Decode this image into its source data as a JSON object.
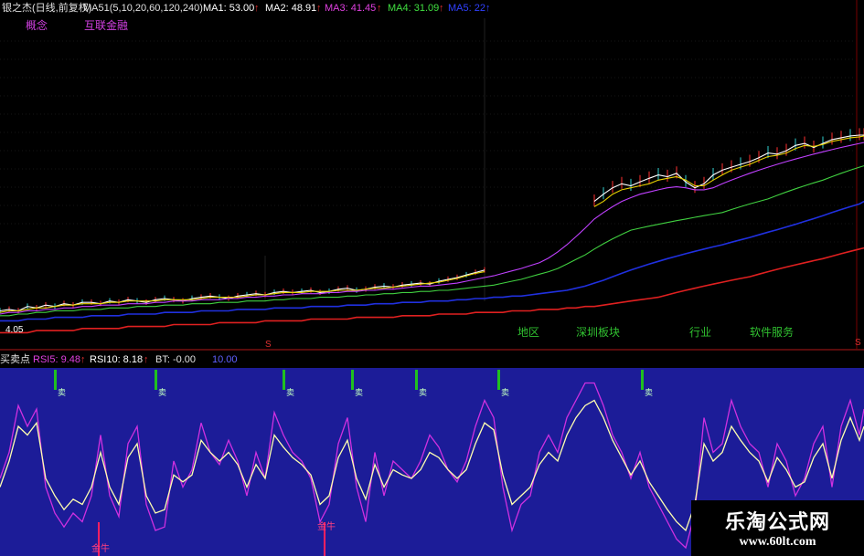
{
  "colors": {
    "ma1": "#ffffff",
    "ma2": "#e6d000",
    "ma3": "#c040ff",
    "ma4": "#40d040",
    "ma5": "#2030e0",
    "ma6": "#e02020",
    "rsi5": "#d030e0",
    "rsi10": "#ffffb0",
    "lower_bg": "#1c1c98",
    "sell_flag": "#20c020",
    "buy_flag": "#ff2060",
    "concept_text": "#d040e0",
    "sector_text": "#30c030"
  },
  "header": {
    "title": "银之杰(日线,前复权)",
    "ma_label": "MA51(5,10,20,60,120,240)",
    "ma_values": [
      {
        "label": "MA1: 53.00",
        "color": "#ffffff"
      },
      {
        "label": "MA2: 48.91",
        "color": "#ffffff"
      },
      {
        "label": "MA3: 41.45",
        "color": "#e040e0"
      },
      {
        "label": "MA4: 31.09",
        "color": "#40e040"
      },
      {
        "label": "MA5: 22",
        "color": "#3040ff"
      }
    ],
    "concept_label": "概念",
    "concept_value": "互联金融"
  },
  "sector_labels": [
    "地区",
    "深圳板块",
    "行业",
    "软件服务"
  ],
  "low_price_label": "4.05",
  "lower": {
    "title": "买卖点",
    "legend": [
      {
        "label": "RSI5: 9.48",
        "color": "#e040e0"
      },
      {
        "label": "RSI10: 8.18",
        "color": "#ffffff"
      },
      {
        "label": "BT: -0.00",
        "color": "#e0e0e0"
      },
      {
        "label": "10.00",
        "color": "#6060ff"
      }
    ],
    "sell_label": "卖",
    "buy_labels": [
      "金牛",
      "金牛"
    ]
  },
  "watermark": {
    "line1": "乐淘公式网",
    "line2": "www.60lt.com"
  },
  "chart_data": [
    {
      "type": "line",
      "panel": "price",
      "x": [
        0,
        10,
        20,
        30,
        40,
        50,
        60,
        70,
        80,
        90,
        100,
        110,
        120,
        130,
        140,
        150,
        160,
        170,
        180,
        190,
        200,
        210,
        220,
        230,
        240,
        250,
        260,
        270,
        280,
        290,
        300,
        310,
        320,
        330,
        340,
        350,
        360,
        370,
        380,
        390,
        400,
        410,
        420,
        430,
        440,
        450,
        460,
        470,
        480,
        490,
        500,
        510,
        520,
        530,
        540,
        550,
        560,
        570,
        580,
        590,
        600,
        610,
        620,
        630,
        640,
        650,
        660,
        670,
        680,
        690,
        700,
        710,
        720,
        730,
        740,
        750,
        760,
        770,
        780,
        790,
        800,
        810,
        820,
        830,
        840,
        850,
        860,
        870,
        880,
        890,
        900,
        910,
        920,
        930,
        940,
        945
      ],
      "series": [
        {
          "name": "MA1",
          "values": [
            4.0,
            4.1,
            4.0,
            4.3,
            4.2,
            4.4,
            4.3,
            4.5,
            4.4,
            4.6,
            4.6,
            4.5,
            4.7,
            4.6,
            4.8,
            4.7,
            4.6,
            4.8,
            4.9,
            4.8,
            4.7,
            4.9,
            5.0,
            5.1,
            5.0,
            4.9,
            5.1,
            5.2,
            5.3,
            5.2,
            5.4,
            5.5,
            5.4,
            5.5,
            5.6,
            5.4,
            5.5,
            5.7,
            5.8,
            5.6,
            5.7,
            5.9,
            6.0,
            5.9,
            6.1,
            6.2,
            6.3,
            6.2,
            6.5,
            6.7,
            6.9,
            7.2,
            7.5,
            7.8,
            null,
            null,
            null,
            null,
            null,
            null,
            null,
            null,
            null,
            null,
            null,
            24,
            27,
            30,
            32,
            31,
            33,
            35,
            37,
            36,
            38,
            33,
            30,
            32,
            37,
            40,
            42,
            44,
            46,
            49,
            53,
            52,
            55,
            60,
            62,
            58,
            62,
            66,
            68,
            70,
            71,
            71
          ]
        },
        {
          "name": "MA2",
          "values": [
            3.9,
            4.0,
            4.0,
            4.1,
            4.2,
            4.2,
            4.3,
            4.4,
            4.4,
            4.5,
            4.5,
            4.5,
            4.6,
            4.6,
            4.7,
            4.7,
            4.7,
            4.7,
            4.8,
            4.8,
            4.8,
            4.8,
            4.9,
            5.0,
            5.0,
            5.0,
            5.0,
            5.1,
            5.2,
            5.2,
            5.3,
            5.4,
            5.4,
            5.4,
            5.5,
            5.5,
            5.5,
            5.6,
            5.6,
            5.6,
            5.7,
            5.8,
            5.8,
            5.9,
            6.0,
            6.1,
            6.2,
            6.3,
            6.4,
            6.6,
            6.8,
            7.1,
            7.4,
            7.6,
            null,
            null,
            null,
            null,
            null,
            null,
            null,
            null,
            null,
            null,
            null,
            22,
            24,
            27,
            29,
            30,
            31,
            32,
            34,
            35,
            36,
            34,
            31,
            31,
            34,
            37,
            40,
            42,
            44,
            47,
            50,
            51,
            53,
            57,
            60,
            59,
            61,
            64,
            66,
            68,
            69,
            70
          ]
        },
        {
          "name": "MA3",
          "values": [
            3.8,
            3.9,
            3.9,
            4.0,
            4.0,
            4.1,
            4.1,
            4.2,
            4.2,
            4.3,
            4.3,
            4.4,
            4.4,
            4.4,
            4.5,
            4.5,
            4.5,
            4.6,
            4.6,
            4.7,
            4.7,
            4.7,
            4.8,
            4.8,
            4.8,
            4.9,
            4.9,
            5.0,
            5.0,
            5.1,
            5.1,
            5.2,
            5.2,
            5.3,
            5.3,
            5.3,
            5.4,
            5.4,
            5.5,
            5.5,
            5.6,
            5.6,
            5.7,
            5.7,
            5.8,
            5.9,
            6.0,
            6.0,
            6.1,
            6.2,
            6.3,
            6.5,
            6.7,
            6.9,
            7.1,
            7.4,
            7.7,
            8.0,
            8.4,
            8.8,
            9.5,
            10.5,
            11.8,
            13.5,
            15.5,
            18,
            20,
            22,
            24,
            25.5,
            27,
            28,
            29,
            30,
            30.5,
            30,
            29,
            29,
            30,
            32,
            34,
            36,
            38,
            40,
            42,
            44,
            46,
            48,
            50,
            52,
            54,
            56,
            58,
            60,
            62,
            63
          ]
        },
        {
          "name": "MA4",
          "values": [
            3.7,
            3.7,
            3.8,
            3.8,
            3.9,
            3.9,
            4.0,
            4.0,
            4.0,
            4.1,
            4.1,
            4.1,
            4.2,
            4.2,
            4.2,
            4.3,
            4.3,
            4.3,
            4.4,
            4.4,
            4.4,
            4.5,
            4.5,
            4.5,
            4.6,
            4.6,
            4.6,
            4.7,
            4.7,
            4.7,
            4.8,
            4.8,
            4.9,
            4.9,
            4.9,
            5.0,
            5.0,
            5.0,
            5.1,
            5.1,
            5.2,
            5.2,
            5.3,
            5.3,
            5.4,
            5.4,
            5.5,
            5.5,
            5.6,
            5.6,
            5.7,
            5.8,
            5.9,
            6.0,
            6.1,
            6.3,
            6.5,
            6.7,
            7.0,
            7.3,
            7.6,
            8.0,
            8.6,
            9.3,
            10,
            11,
            12,
            13,
            14,
            15,
            15.5,
            16,
            16.5,
            17,
            17.5,
            18,
            18.5,
            19,
            19.5,
            20,
            21,
            22,
            23,
            24,
            25,
            26.5,
            28,
            29.5,
            31,
            32.5,
            34,
            36,
            38,
            40,
            42,
            43
          ]
        },
        {
          "name": "MA5",
          "values": [
            3.4,
            3.4,
            3.4,
            3.5,
            3.5,
            3.5,
            3.6,
            3.6,
            3.6,
            3.6,
            3.7,
            3.7,
            3.7,
            3.7,
            3.8,
            3.8,
            3.8,
            3.8,
            3.9,
            3.9,
            3.9,
            3.9,
            4.0,
            4.0,
            4.0,
            4.0,
            4.1,
            4.1,
            4.1,
            4.1,
            4.2,
            4.2,
            4.2,
            4.2,
            4.3,
            4.3,
            4.3,
            4.3,
            4.4,
            4.4,
            4.4,
            4.5,
            4.5,
            4.5,
            4.6,
            4.6,
            4.6,
            4.7,
            4.7,
            4.7,
            4.8,
            4.8,
            4.9,
            4.9,
            5.0,
            5.0,
            5.1,
            5.1,
            5.2,
            5.3,
            5.4,
            5.5,
            5.6,
            5.8,
            6.0,
            6.3,
            6.6,
            7.0,
            7.4,
            7.8,
            8.2,
            8.6,
            9,
            9.4,
            9.8,
            10.2,
            10.6,
            11,
            11.4,
            11.8,
            12.3,
            12.8,
            13.3,
            13.9,
            14.5,
            15.1,
            15.8,
            16.5,
            17.3,
            18.1,
            19,
            20,
            21,
            22,
            23,
            24
          ]
        },
        {
          "name": "MA6",
          "values": [
            2.8,
            2.8,
            2.8,
            2.8,
            2.9,
            2.9,
            2.9,
            2.9,
            2.9,
            3.0,
            3.0,
            3.0,
            3.0,
            3.0,
            3.1,
            3.1,
            3.1,
            3.1,
            3.1,
            3.2,
            3.2,
            3.2,
            3.2,
            3.2,
            3.3,
            3.3,
            3.3,
            3.3,
            3.3,
            3.4,
            3.4,
            3.4,
            3.4,
            3.4,
            3.5,
            3.5,
            3.5,
            3.5,
            3.5,
            3.6,
            3.6,
            3.6,
            3.6,
            3.6,
            3.7,
            3.7,
            3.7,
            3.7,
            3.8,
            3.8,
            3.8,
            3.8,
            3.9,
            3.9,
            3.9,
            3.9,
            4.0,
            4.0,
            4.0,
            4.1,
            4.1,
            4.1,
            4.2,
            4.2,
            4.3,
            4.3,
            4.4,
            4.5,
            4.6,
            4.7,
            4.8,
            4.9,
            5.0,
            5.2,
            5.4,
            5.6,
            5.8,
            6.0,
            6.2,
            6.4,
            6.6,
            6.8,
            7.0,
            7.3,
            7.6,
            7.9,
            8.2,
            8.5,
            8.8,
            9.1,
            9.4,
            9.8,
            10.2,
            10.6,
            11,
            11.2
          ]
        }
      ]
    },
    {
      "type": "line",
      "panel": "rsi",
      "ylim": [
        0,
        100
      ],
      "x": [
        0,
        10,
        20,
        30,
        40,
        50,
        60,
        70,
        80,
        90,
        100,
        110,
        120,
        130,
        140,
        150,
        160,
        170,
        180,
        190,
        200,
        210,
        220,
        230,
        240,
        250,
        260,
        270,
        280,
        290,
        300,
        310,
        320,
        330,
        340,
        350,
        360,
        370,
        380,
        390,
        400,
        410,
        420,
        430,
        440,
        450,
        460,
        470,
        480,
        490,
        500,
        510,
        520,
        530,
        540,
        550,
        560,
        570,
        580,
        590,
        600,
        610,
        620,
        630,
        640,
        650,
        660,
        670,
        680,
        690,
        700,
        710,
        720,
        730,
        740,
        750,
        760,
        770,
        780,
        790,
        800,
        810,
        820,
        830,
        840,
        850,
        860,
        870,
        880,
        890,
        900,
        910,
        920,
        930,
        940,
        945
      ],
      "series": [
        {
          "name": "RSI5",
          "values": [
            40,
            55,
            82,
            70,
            80,
            35,
            20,
            12,
            20,
            15,
            30,
            65,
            30,
            18,
            60,
            70,
            25,
            10,
            12,
            50,
            35,
            45,
            72,
            55,
            48,
            62,
            50,
            30,
            55,
            40,
            78,
            65,
            55,
            50,
            40,
            15,
            25,
            60,
            75,
            35,
            15,
            55,
            30,
            50,
            45,
            40,
            50,
            65,
            58,
            45,
            38,
            50,
            70,
            85,
            75,
            35,
            10,
            25,
            30,
            55,
            65,
            55,
            75,
            85,
            95,
            95,
            82,
            65,
            55,
            40,
            55,
            35,
            25,
            15,
            5,
            0,
            20,
            75,
            55,
            60,
            85,
            70,
            60,
            55,
            35,
            60,
            50,
            30,
            40,
            60,
            70,
            35,
            70,
            85,
            65,
            80
          ]
        },
        {
          "name": "RSI10",
          "values": [
            35,
            50,
            70,
            65,
            72,
            40,
            30,
            22,
            28,
            25,
            35,
            55,
            35,
            25,
            52,
            60,
            30,
            20,
            22,
            42,
            38,
            42,
            62,
            55,
            50,
            55,
            48,
            35,
            48,
            40,
            65,
            58,
            52,
            48,
            42,
            25,
            30,
            52,
            62,
            40,
            28,
            48,
            35,
            45,
            42,
            40,
            45,
            55,
            52,
            45,
            40,
            45,
            60,
            72,
            68,
            42,
            25,
            30,
            35,
            48,
            55,
            50,
            65,
            75,
            82,
            85,
            75,
            62,
            52,
            42,
            50,
            38,
            30,
            22,
            15,
            10,
            25,
            60,
            50,
            55,
            70,
            62,
            55,
            50,
            38,
            52,
            45,
            35,
            38,
            52,
            60,
            40,
            62,
            75,
            62,
            70
          ]
        }
      ]
    }
  ]
}
